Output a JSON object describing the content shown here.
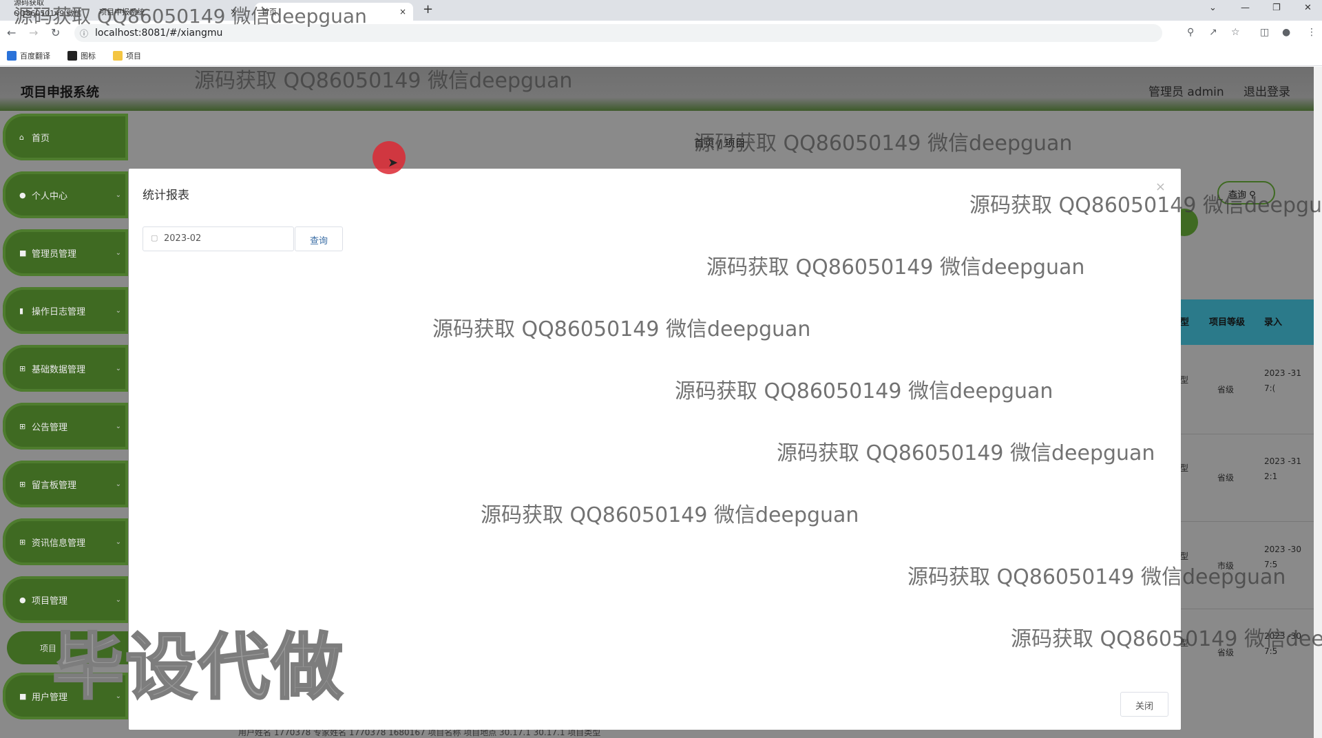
{
  "browser": {
    "tabs": [
      {
        "label": "源码获取 QQ86050149 微信deepguan"
      },
      {
        "label": "项目申报系统"
      },
      {
        "label": "首页"
      }
    ],
    "tab_close": "×",
    "new_tab": "+",
    "window_controls": [
      "⌄",
      "—",
      "❐",
      "✕"
    ],
    "url": "localhost:8081/#/xiangmu",
    "bookmarks": [
      {
        "label": "百度翻译",
        "color": "#2a72d9"
      },
      {
        "label": "图标",
        "color": "#222222"
      },
      {
        "label": "项目",
        "color": "#f4c542"
      }
    ]
  },
  "app": {
    "title": "项目申报系统",
    "admin_label": "管理员 admin",
    "logout": "退出登录",
    "breadcrumb": "首页 / 项目",
    "search_label": "查询",
    "accent_color": "#3f6a22",
    "sidebar": [
      {
        "label": "首页",
        "icon": "home-icon"
      },
      {
        "label": "个人中心",
        "icon": "user-icon"
      },
      {
        "label": "管理员管理",
        "icon": "monitor-icon"
      },
      {
        "label": "操作日志管理",
        "icon": "doc-icon"
      },
      {
        "label": "基础数据管理",
        "icon": "grid-icon"
      },
      {
        "label": "公告管理",
        "icon": "grid-icon"
      },
      {
        "label": "留言板管理",
        "icon": "grid-icon"
      },
      {
        "label": "资讯信息管理",
        "icon": "grid-icon"
      },
      {
        "label": "项目管理",
        "icon": "user-icon"
      },
      {
        "label": "用户管理",
        "icon": "monitor-icon"
      }
    ],
    "sidebar_sub": "项目",
    "table": {
      "headers": [
        "型",
        "项目等级",
        "录入"
      ],
      "rows": [
        {
          "type": "型",
          "level": "省级",
          "date": "2023 -31 7:("
        },
        {
          "type": "型",
          "level": "省级",
          "date": "2023 -31 2:1"
        },
        {
          "type": "型",
          "level": "市级",
          "date": "2023 -30 7:5"
        },
        {
          "type": "型",
          "level": "省级",
          "date": "2023 -30 7:5"
        }
      ],
      "partial_row": "用户姓名   1770378        专家姓名   1770378         1680167   项目名称              项目地点    30.17.1    30.17.1   项目类型"
    }
  },
  "modal": {
    "title": "统计报表",
    "close_x": "×",
    "month_value": "2023-02",
    "query_button": "查询",
    "close_button": "关闭"
  },
  "watermarks": {
    "text": "源码获取 QQ86050149 微信deepguan",
    "big": "毕设代做"
  }
}
